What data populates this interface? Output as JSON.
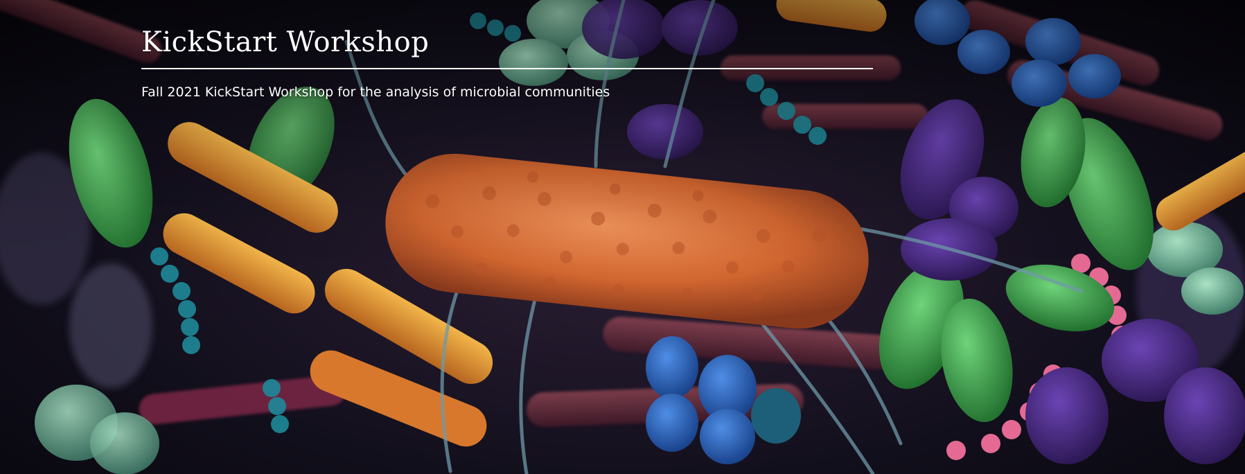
{
  "header": {
    "title": "KickStart Workshop",
    "subtitle": "Fall 2021 KickStart Workshop for the analysis of microbial communities"
  },
  "banner": {
    "image": "microbial-community-illustration",
    "colors": {
      "central_bacterium": "#d9743a",
      "rod_bacteria": "#e2a03a",
      "green_cells": "#3fae4e",
      "purple_cells": "#4b2a86",
      "blue_cocci": "#2f6bc7",
      "pink_chains": "#e46a93",
      "teal_chains": "#1e8a9a",
      "background_rods": "#7a3a4a"
    }
  }
}
